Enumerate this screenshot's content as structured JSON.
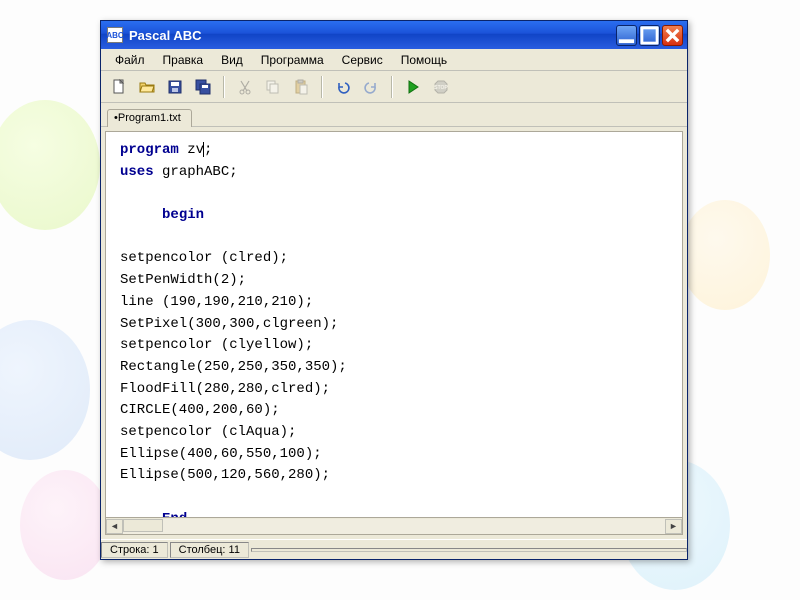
{
  "window": {
    "title": "Pascal ABC",
    "app_icon_text": "ABC"
  },
  "menu": {
    "items": [
      "Файл",
      "Правка",
      "Вид",
      "Программа",
      "Сервис",
      "Помощь"
    ]
  },
  "toolbar": {
    "new": "new-file",
    "open": "open-file",
    "save": "save",
    "saveall": "save-all",
    "cut": "cut",
    "copy": "copy",
    "paste": "paste",
    "undo": "undo",
    "redo": "redo",
    "run": "run",
    "stop": "stop"
  },
  "tabs": [
    {
      "label": "•Program1.txt",
      "modified": true
    }
  ],
  "code": {
    "lines": [
      {
        "t": "kw",
        "s": "program",
        "rest": " zv",
        "cursor": true,
        "tail": ";"
      },
      {
        "t": "kw",
        "s": "uses",
        "rest": " graphABC;"
      },
      {
        "blank": true
      },
      {
        "indent": "     ",
        "t": "kw",
        "s": "begin"
      },
      {
        "blank": true
      },
      {
        "rest": "setpencolor (clred);"
      },
      {
        "rest": "SetPenWidth(2);"
      },
      {
        "rest": "line (190,190,210,210);"
      },
      {
        "rest": "SetPixel(300,300,clgreen);"
      },
      {
        "rest": "setpencolor (clyellow);"
      },
      {
        "rest": "Rectangle(250,250,350,350);"
      },
      {
        "rest": "FloodFill(280,280,clred);"
      },
      {
        "rest": "CIRCLE(400,200,60);"
      },
      {
        "rest": "setpencolor (clAqua);"
      },
      {
        "rest": "Ellipse(400,60,550,100);"
      },
      {
        "rest": "Ellipse(500,120,560,280);"
      },
      {
        "blank": true
      },
      {
        "indent": "     ",
        "t": "kw",
        "s": "End",
        "rest": "."
      }
    ]
  },
  "status": {
    "row_label": "Строка:",
    "row": "1",
    "col_label": "Столбец:",
    "col": "11"
  }
}
